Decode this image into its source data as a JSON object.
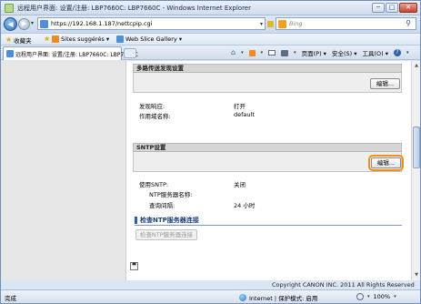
{
  "window": {
    "title": "远程用户界面: 设置/注册: LBP7660C: LBP7660C - Windows Internet Explorer",
    "min": "─",
    "max": "□",
    "close": "✕"
  },
  "address": {
    "back": "◀",
    "forward": "▶",
    "url": "https://192.168.1.187/nettcpip.cgi",
    "search_placeholder": "Bing"
  },
  "favorites": {
    "label": "收藏夹",
    "items": [
      "Sites suggérés ▾",
      "Web Slice Gallery ▾"
    ]
  },
  "tab": {
    "label": "远程用户界面: 设置/注册: LBP7660C: LBP7660C"
  },
  "commands": {
    "page": "页面(P) ▾",
    "safety": "安全(S) ▾",
    "tools": "工具(O) ▾"
  },
  "sections": {
    "multicast": {
      "header": "多路传送发现设置",
      "edit": "编辑...",
      "rows": [
        {
          "label": "发现响应:",
          "value": "打开"
        },
        {
          "label": "作用域名称:",
          "value": "default"
        }
      ]
    },
    "sntp": {
      "header": "SNTP设置",
      "edit": "编辑...",
      "rows": [
        {
          "label": "使用SNTP:",
          "value": "关闭"
        },
        {
          "label": "NTP服务器名称:",
          "value": ""
        },
        {
          "label": "查询间隔:",
          "value": "24 小时"
        }
      ]
    },
    "check": {
      "title": "检查NTP服务器连接",
      "button": "检查NTP服务器连接"
    }
  },
  "footer": {
    "copyright": "Copyright CANON INC. 2011 All Rights Reserved"
  },
  "status": {
    "left": "完成",
    "zone": "Internet | 保护模式: 启用",
    "zoom": "100%"
  }
}
